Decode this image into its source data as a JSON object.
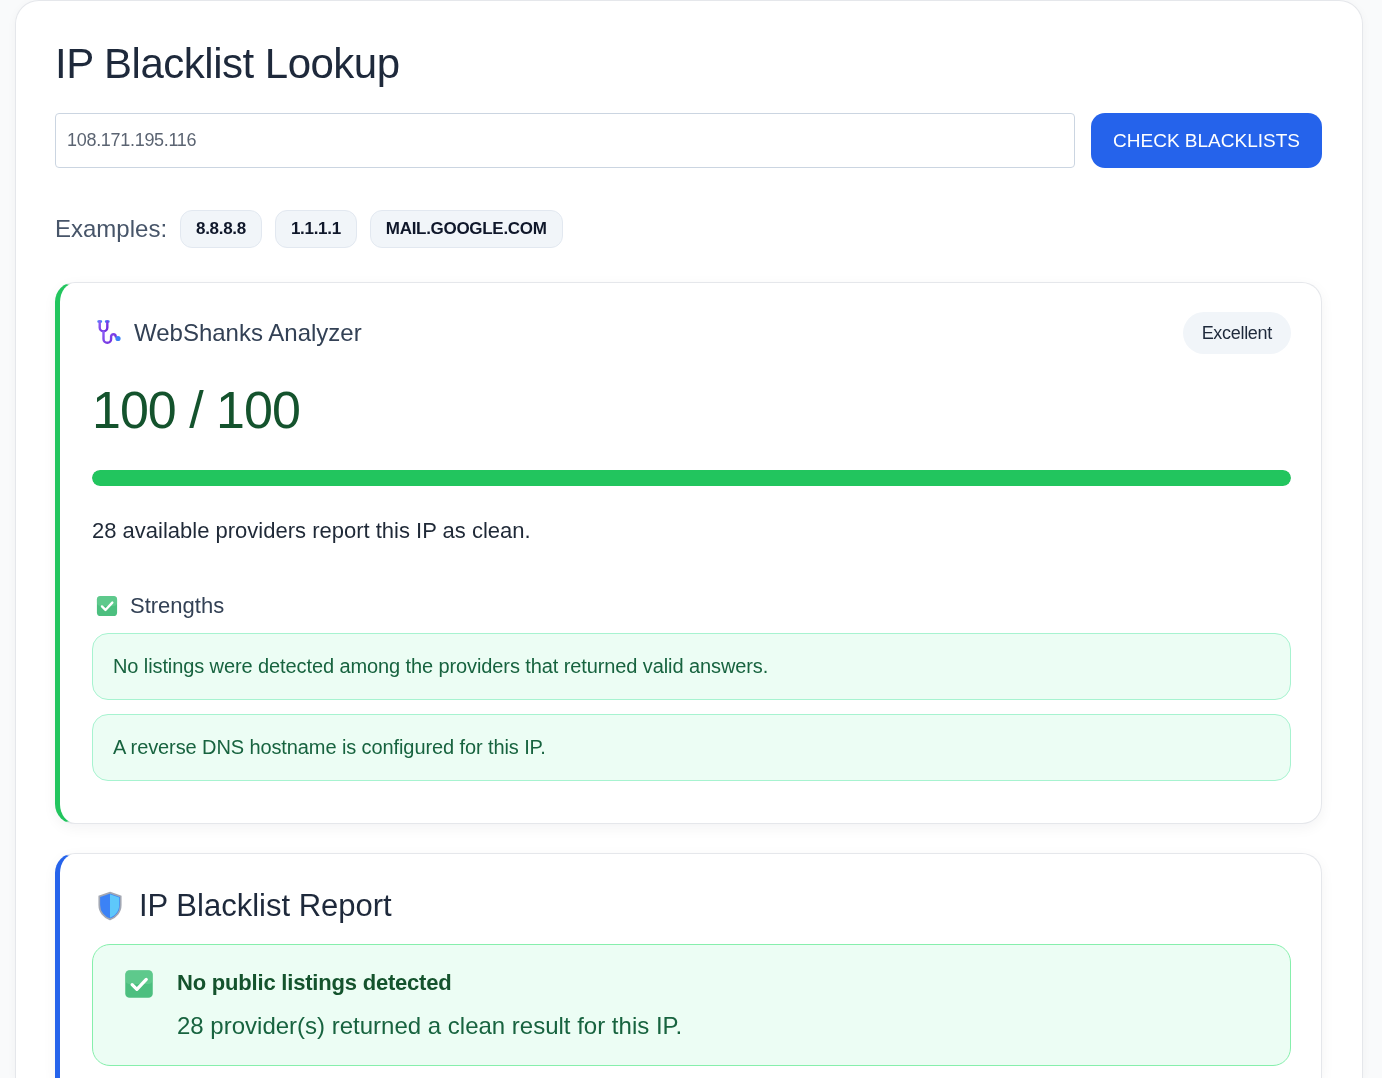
{
  "page": {
    "title": "IP Blacklist Lookup"
  },
  "lookup": {
    "input": {
      "value": "108.171.195.116"
    },
    "button": "CHECK BLACKLISTS"
  },
  "examples": {
    "label": "Examples:",
    "items": [
      "8.8.8.8",
      "1.1.1.1",
      "MAIL.GOOGLE.COM"
    ]
  },
  "analyzer": {
    "title": "WebShanks Analyzer",
    "badge": "Excellent",
    "score": "100 / 100",
    "level": 1,
    "summary": "28 available providers report this IP as clean.",
    "strengths": {
      "title": "Strengths",
      "items": [
        "No listings were detected among the providers that returned valid answers.",
        "A reverse DNS hostname is configured for this IP."
      ]
    }
  },
  "report": {
    "title": "IP Blacklist Report",
    "result": {
      "title": "No public listings detected",
      "description": "28 provider(s) returned a clean result for this IP."
    }
  }
}
